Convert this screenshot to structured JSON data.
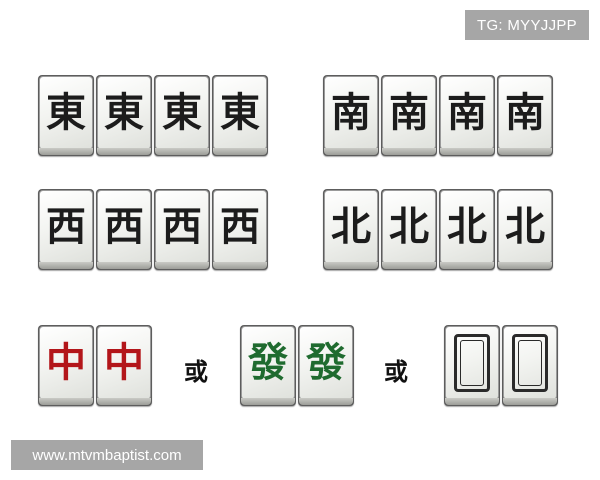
{
  "tag_label": "TG: MYYJJPP",
  "watermark": "www.mtvmbaptist.com",
  "winds": {
    "east": [
      "東",
      "東",
      "東",
      "東"
    ],
    "south": [
      "南",
      "南",
      "南",
      "南"
    ],
    "west": [
      "西",
      "西",
      "西",
      "西"
    ],
    "north": [
      "北",
      "北",
      "北",
      "北"
    ]
  },
  "dragons": {
    "red": [
      "中",
      "中"
    ],
    "green": [
      "發",
      "發"
    ],
    "white_icon": "white-dragon-frame-icon"
  },
  "or_text": "或",
  "colors": {
    "red_dragon": "#b3161a",
    "green_dragon": "#1f6b2f",
    "wind_ink": "#1c1c1c"
  }
}
